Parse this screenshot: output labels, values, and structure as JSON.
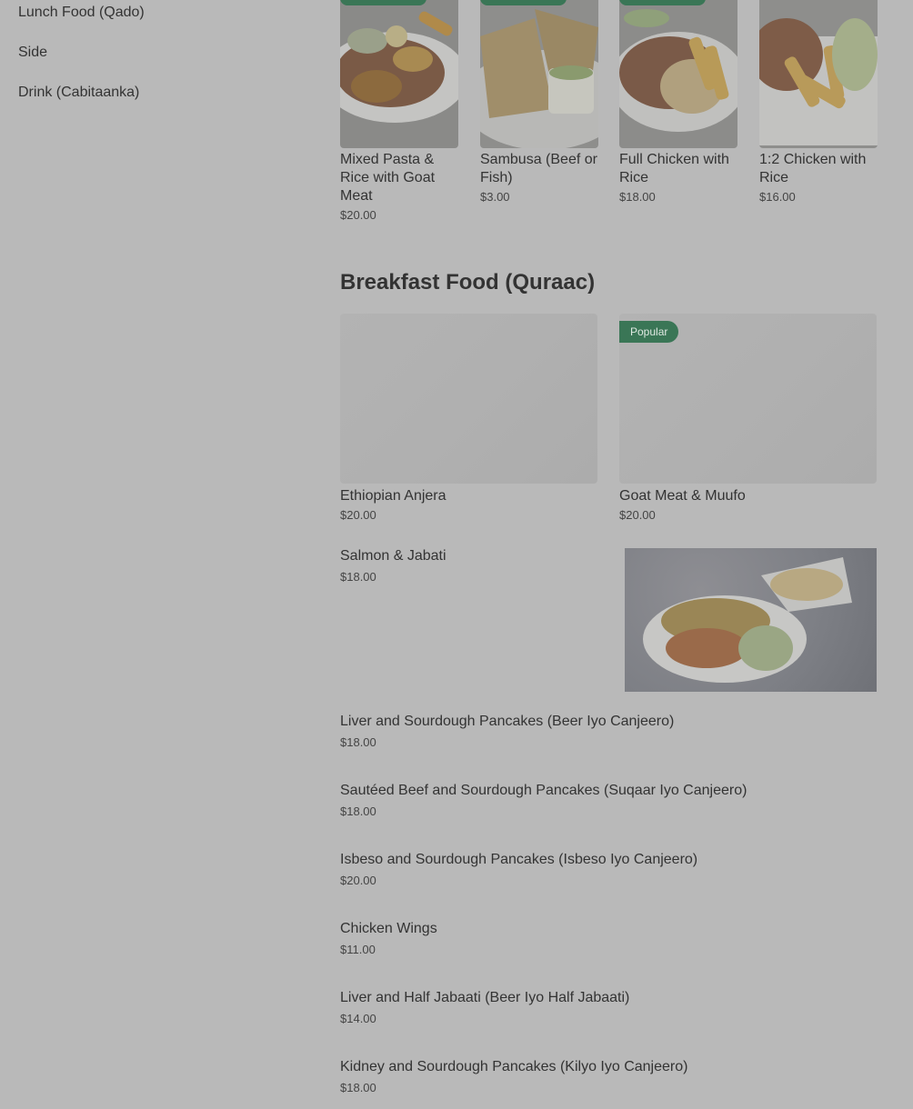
{
  "sidebar": {
    "items": [
      {
        "label": "Lunch Food (Qado)"
      },
      {
        "label": "Side"
      },
      {
        "label": "Drink (Cabitaanka)"
      }
    ]
  },
  "lunch_items": [
    {
      "name": "Mixed Pasta & Rice with Goat Meat",
      "price": "$20.00"
    },
    {
      "name": "Sambusa (Beef or Fish)",
      "price": "$3.00"
    },
    {
      "name": "Full Chicken with Rice",
      "price": "$18.00"
    },
    {
      "name": "1:2 Chicken with Rice",
      "price": "$16.00"
    }
  ],
  "breakfast": {
    "title": "Breakfast Food (Quraac)",
    "featured": [
      {
        "name": "Ethiopian Anjera",
        "price": "$20.00",
        "badge": ""
      },
      {
        "name": "Goat Meat & Muufo",
        "price": "$20.00",
        "badge": "Popular"
      }
    ],
    "list": [
      {
        "name": "Salmon & Jabati",
        "price": "$18.00"
      },
      {
        "name": "Liver and Sourdough Pancakes (Beer Iyo Canjeero)",
        "price": "$18.00"
      },
      {
        "name": "Sautéed Beef and Sourdough Pancakes (Suqaar Iyo Canjeero)",
        "price": "$18.00"
      },
      {
        "name": "Isbeso and Sourdough Pancakes (Isbeso Iyo Canjeero)",
        "price": "$20.00"
      },
      {
        "name": "Chicken Wings",
        "price": "$11.00"
      },
      {
        "name": "Liver and Half Jabaati (Beer Iyo Half Jabaati)",
        "price": "$14.00"
      },
      {
        "name": "Kidney and Sourdough Pancakes (Kilyo Iyo Canjeero)",
        "price": "$18.00"
      }
    ]
  },
  "colors": {
    "overlay": "#b9b9b9",
    "badge_green": "#3a7656"
  }
}
